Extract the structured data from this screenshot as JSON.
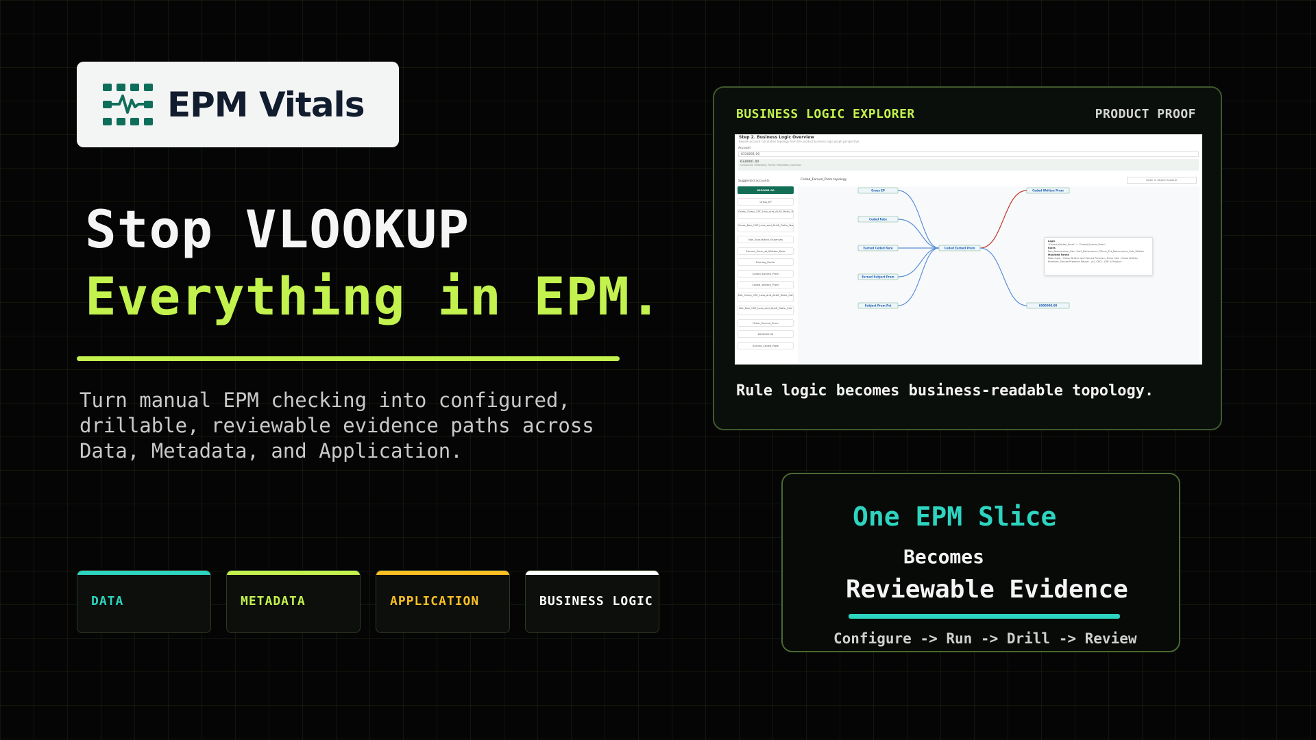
{
  "brand": {
    "name": "EPM Vitals",
    "logo_icon": "pulse-grid-icon",
    "logo_color": "#0f6e5a"
  },
  "hero": {
    "headline_line1": "Stop VLOOKUP",
    "headline_line2": "Everything in EPM.",
    "description": "Turn manual EPM checking into configured,\ndrillable, reviewable evidence paths across\nData, Metadata, and Application.",
    "accent_color": "#c3f24e"
  },
  "pillars": [
    {
      "label": "DATA",
      "color": "#2dd4bf"
    },
    {
      "label": "METADATA",
      "color": "#c3f24e"
    },
    {
      "label": "APPLICATION",
      "color": "#fbbf24"
    },
    {
      "label": "BUSINESS LOGIC",
      "color": "#ffffff"
    }
  ],
  "explorer": {
    "title": "BUSINESS LOGIC EXPLORER",
    "badge": "PRODUCT PROOF",
    "caption": "Rule logic becomes business-readable topology.",
    "screenshot": {
      "step_title": "Step 2. Business Logic Overview",
      "step_subtitle": "Review account calculation topology from the product business logic graph perspective.",
      "account_label": "Account",
      "account_value": "6330001.00",
      "selected_account": "6330001.00",
      "selected_detail": "Computed: Metadata | Parent: Metadata_Expenses",
      "suggested_label": "Suggested accounts",
      "topology_label": "Ceded_Earned_Prem topology",
      "open_button": "Open in Object Explorer",
      "accounts": [
        "6330001.00",
        "Gross_EP",
        "Gross_Comp_CAT_Loss_and_ALAE_Ratio_YearTotal",
        "Gross_Non_CAT_Loss_and_ALAE_Ratio_YearTotal",
        "Non_Acquisition_Expenses",
        "Earned_Prem_at_Written_Rate",
        "Earning_Factor",
        "Ceded_Earned_Prem",
        "Ceded_Written_Prem",
        "Net_Comp_CAT_Loss_and_ALAE_Ratio_Calc",
        "Net_Non_CAT_Loss_and_ALAE_Ratio_Calc",
        "Other_Earned_Prem",
        "6000000.00",
        "Earned_Ceded_Rate"
      ],
      "nodes_left": [
        "Gross EP",
        "Ceded Rate",
        "Earned Ceded Rate",
        "Earned Subject Prem",
        "Subject Prem Pct"
      ],
      "node_center": "Ceded Earned Prem",
      "nodes_right": [
        "Ceded Written Prem",
        "6000000.00"
      ],
      "tooltip": {
        "logic_title": "Logic",
        "logic_text": "\"Ceded_Written_Prem\" = \"Ceded_Earned_Prem\"",
        "rules_title": "Rules",
        "rules_text": "Ben_Reinsurance_Calc, Pre1_Reinsurance, PPrem_Pct_Reinsurance_Calc_Written",
        "forms_title": "Mounted Forms",
        "forms_text": "Data Input - Gross Written and Earned Premium, Drive Calc - Gross Written Premium, Earned Premium Report - ALL CPCL, LOB % Product"
      }
    }
  },
  "evidence": {
    "line1": "One EPM Slice",
    "line2": "Becomes",
    "line3": "Reviewable Evidence",
    "flow": "Configure -> Run -> Drill -> Review",
    "accent_color": "#2dd4bf"
  }
}
